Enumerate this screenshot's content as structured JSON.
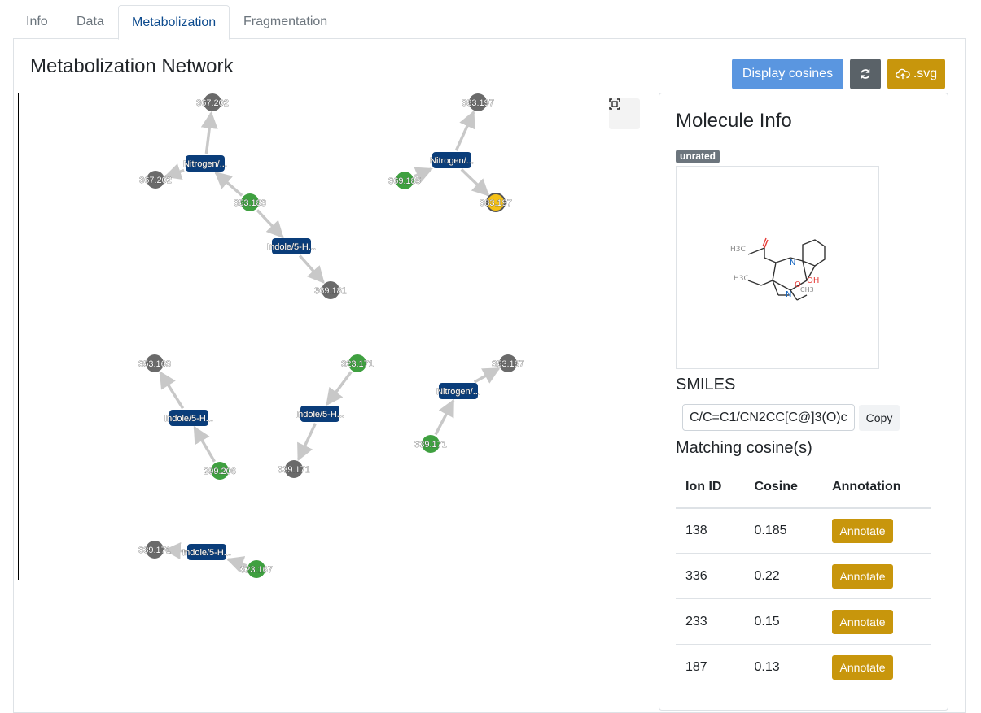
{
  "tabs": [
    {
      "label": "Info",
      "active": false
    },
    {
      "label": "Data",
      "active": false
    },
    {
      "label": "Metabolization",
      "active": true
    },
    {
      "label": "Fragmentation",
      "active": false
    }
  ],
  "page_title": "Metabolization Network",
  "toolbar": {
    "display_cosines_label": "Display cosines",
    "refresh_icon": "refresh-icon",
    "svg_label": ".svg",
    "svg_icon": "cloud-upload-icon"
  },
  "network": {
    "fit_icon": "fit-to-screen-icon",
    "colors": {
      "reaction": "#0a3d7a",
      "known": "#3fa040",
      "predicted": "#6a6a6a",
      "selected": "#f5c116",
      "edge": "#c8c8c8"
    },
    "nodes": [
      {
        "id": "g1",
        "label": "367.202",
        "kind": "predicted"
      },
      {
        "id": "g2",
        "label": "367.202",
        "kind": "predicted"
      },
      {
        "id": "r1",
        "label": "Nitrogen/...",
        "kind": "reaction"
      },
      {
        "id": "k1",
        "label": "353.183",
        "kind": "known"
      },
      {
        "id": "r2",
        "label": "Indole/5-H...",
        "kind": "reaction"
      },
      {
        "id": "g3",
        "label": "369.181",
        "kind": "predicted"
      },
      {
        "id": "g4",
        "label": "383.197",
        "kind": "predicted"
      },
      {
        "id": "r3",
        "label": "Nitrogen/...",
        "kind": "reaction"
      },
      {
        "id": "k2",
        "label": "369.185",
        "kind": "known"
      },
      {
        "id": "s1",
        "label": "383.197",
        "kind": "selected"
      },
      {
        "id": "g5",
        "label": "353.163",
        "kind": "predicted"
      },
      {
        "id": "r4",
        "label": "Indole/5-H...",
        "kind": "reaction"
      },
      {
        "id": "k3",
        "label": "299.206",
        "kind": "known"
      },
      {
        "id": "k4",
        "label": "323.171",
        "kind": "known"
      },
      {
        "id": "r5",
        "label": "Indole/5-H...",
        "kind": "reaction"
      },
      {
        "id": "g6",
        "label": "339.171",
        "kind": "predicted"
      },
      {
        "id": "g7",
        "label": "353.187",
        "kind": "predicted"
      },
      {
        "id": "r6",
        "label": "Nitrogen/...",
        "kind": "reaction"
      },
      {
        "id": "k5",
        "label": "339.171",
        "kind": "known"
      },
      {
        "id": "g8",
        "label": "339.171",
        "kind": "predicted"
      },
      {
        "id": "r7",
        "label": "Indole/5-H...",
        "kind": "reaction"
      },
      {
        "id": "k6",
        "label": "323.167",
        "kind": "known"
      }
    ],
    "edges": [
      [
        "r1",
        "g1"
      ],
      [
        "r1",
        "g2"
      ],
      [
        "k1",
        "r1"
      ],
      [
        "k1",
        "r2"
      ],
      [
        "r2",
        "g3"
      ],
      [
        "r3",
        "g4"
      ],
      [
        "k2",
        "r3"
      ],
      [
        "r3",
        "s1"
      ],
      [
        "r4",
        "g5"
      ],
      [
        "k3",
        "r4"
      ],
      [
        "k4",
        "r5"
      ],
      [
        "r5",
        "g6"
      ],
      [
        "r6",
        "g7"
      ],
      [
        "k5",
        "r6"
      ],
      [
        "r7",
        "g8"
      ],
      [
        "k6",
        "r7"
      ]
    ]
  },
  "molecule": {
    "title": "Molecule Info",
    "rating_badge": "unrated",
    "structure_labels": {
      "methyl_ester": "H3C",
      "ring_n": "N",
      "ethylidene": "H3C",
      "hydroxyl": "OH",
      "methoxy_o": "O",
      "methoxy_ch3": "CH3",
      "amine_n": "N"
    },
    "smiles_label": "SMILES",
    "smiles_value": "C/C=C1/CN2CC[C@]3(O)c",
    "copy_label": "Copy",
    "matching_label": "Matching cosine(s)",
    "table": {
      "headers": [
        "Ion ID",
        "Cosine",
        "Annotation"
      ],
      "rows": [
        {
          "ion_id": "138",
          "cosine": "0.185",
          "action": "Annotate"
        },
        {
          "ion_id": "336",
          "cosine": "0.22",
          "action": "Annotate"
        },
        {
          "ion_id": "233",
          "cosine": "0.15",
          "action": "Annotate"
        },
        {
          "ion_id": "187",
          "cosine": "0.13",
          "action": "Annotate"
        }
      ]
    }
  }
}
